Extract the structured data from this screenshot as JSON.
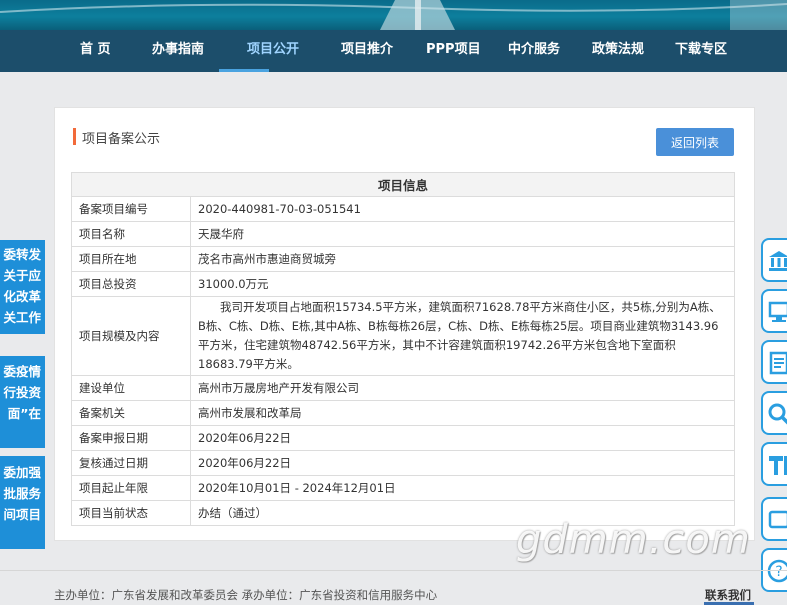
{
  "nav": {
    "items": [
      "首 页",
      "办事指南",
      "项目公开",
      "项目推介",
      "PPP项目",
      "中介服务",
      "政策法规",
      "下载专区"
    ],
    "active_index": 2
  },
  "card": {
    "title": "项目备案公示",
    "back_button": "返回列表",
    "table_header": "项目信息",
    "rows": [
      {
        "label": "备案项目编号",
        "value": "2020-440981-70-03-051541"
      },
      {
        "label": "项目名称",
        "value": "天晟华府"
      },
      {
        "label": "项目所在地",
        "value": "茂名市高州市惠迪商贸城旁"
      },
      {
        "label": "项目总投资",
        "value": "31000.0万元"
      },
      {
        "label": "项目规模及内容",
        "value": "我司开发项目占地面积15734.5平方米，建筑面积71628.78平方米商住小区，共5栋,分别为A栋、B栋、C栋、D栋、E栋,其中A栋、B栋每栋26层，C栋、D栋、E栋每栋25层。项目商业建筑物3143.96平方米，住宅建筑物48742.56平方米，其中不计容建筑面积19742.26平方米包含地下室面积18683.79平方米。"
      },
      {
        "label": "建设单位",
        "value": "高州市万晟房地产开发有限公司"
      },
      {
        "label": "备案机关",
        "value": "高州市发展和改革局"
      },
      {
        "label": "备案申报日期",
        "value": "2020年06月22日"
      },
      {
        "label": "复核通过日期",
        "value": "2020年06月22日"
      },
      {
        "label": "项目起止年限",
        "value": "2020年10月01日 - 2024年12月01日"
      },
      {
        "label": "项目当前状态",
        "value": "办结（通过）"
      }
    ]
  },
  "left_panels": [
    {
      "lines": [
        "委转发",
        "关于应",
        "化改革",
        "关工作"
      ]
    },
    {
      "lines": [
        "委疫情",
        "行投资",
        "面”在"
      ]
    },
    {
      "lines": [
        "委加强",
        "批服务",
        "间项目"
      ]
    }
  ],
  "right_icons": [
    "bank-icon",
    "computer-icon",
    "document-icon",
    "search-icon",
    "tools-icon",
    "monitor-icon",
    "question-icon"
  ],
  "footer": {
    "left": "主办单位：广东省发展和改革委员会    承办单位：广东省投资和信用服务中心",
    "right": "联系我们"
  },
  "watermark": "gdmm.com",
  "colors": {
    "nav_bg": "#1c4e6b",
    "accent": "#4a90d9",
    "panel_blue": "#1e8fd8",
    "title_marker": "#f26a3a"
  }
}
